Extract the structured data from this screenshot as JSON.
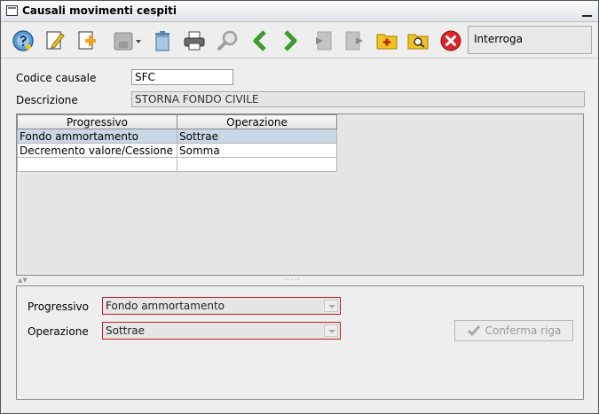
{
  "window": {
    "title": "Causali movimenti cespiti"
  },
  "toolbar": {
    "buttons": [
      {
        "icon": "help-icon"
      },
      {
        "icon": "edit-icon"
      },
      {
        "icon": "new-record-icon"
      },
      {
        "icon": "save-dropdown-icon"
      },
      {
        "icon": "delete-icon"
      },
      {
        "icon": "print-icon"
      },
      {
        "icon": "search-icon"
      },
      {
        "icon": "previous-icon"
      },
      {
        "icon": "next-icon"
      },
      {
        "icon": "import-icon"
      },
      {
        "icon": "export-icon"
      },
      {
        "icon": "add-folder-icon"
      },
      {
        "icon": "search-folder-icon"
      },
      {
        "icon": "close-icon"
      }
    ],
    "mode_label": "Interroga"
  },
  "form": {
    "codice_label": "Codice causale",
    "codice_value": "SFC",
    "descrizione_label": "Descrizione",
    "descrizione_value": "STORNA FONDO CIVILE"
  },
  "grid": {
    "columns": [
      "Progressivo",
      "Operazione"
    ],
    "rows": [
      {
        "progressivo": "Fondo ammortamento",
        "operazione": "Sottrae"
      },
      {
        "progressivo": "Decremento valore/Cessione",
        "operazione": "Somma"
      },
      {
        "progressivo": "",
        "operazione": ""
      }
    ]
  },
  "detail": {
    "progressivo_label": "Progressivo",
    "progressivo_value": "Fondo ammortamento",
    "operazione_label": "Operazione",
    "operazione_value": "Sottrae",
    "confirm_label": "Conferma riga"
  },
  "colors": {
    "error_border": "#c0202a",
    "selected_row": "#c9d7e6",
    "nav_green": "#3f9a2c",
    "close_red": "#d9262d",
    "folder_yellow": "#f2c320"
  }
}
